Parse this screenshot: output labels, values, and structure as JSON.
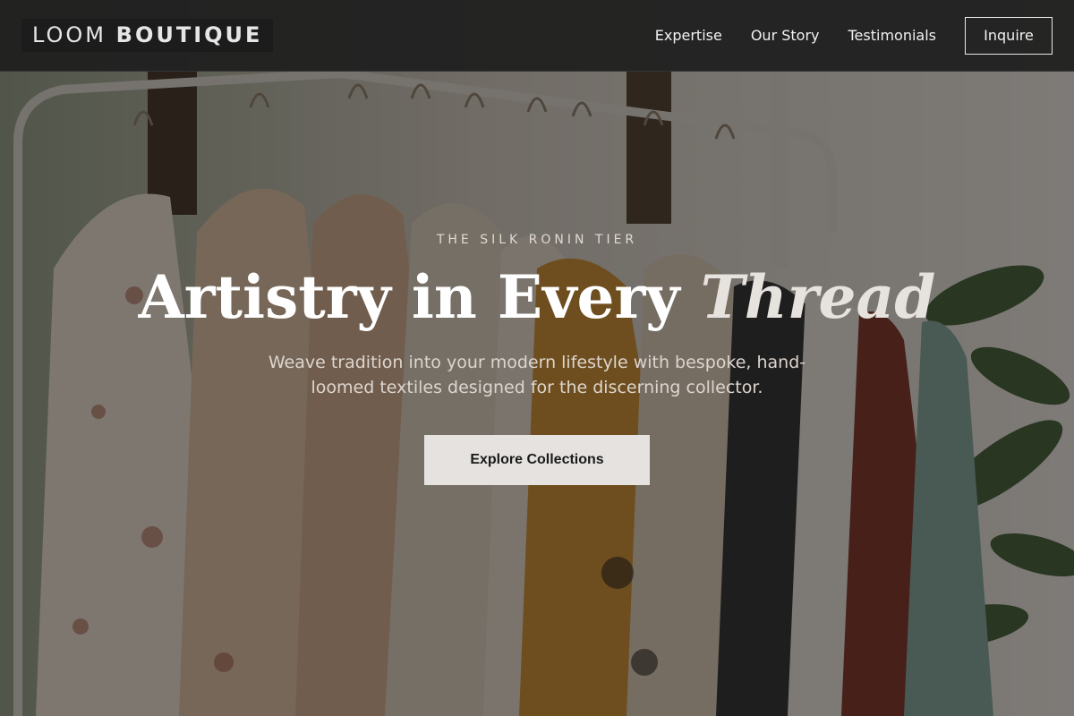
{
  "nav": {
    "logo_light": "LOOM",
    "logo_bold": "BOUTIQUE",
    "links": [
      "Expertise",
      "Our Story",
      "Testimonials"
    ],
    "cta_label": "Inquire"
  },
  "hero": {
    "eyebrow": "THE SILK RONIN TIER",
    "headline_main": "Artistry in Every",
    "headline_accent": "Thread",
    "subtitle": "Weave tradition into your modern lifestyle with bespoke, hand-loomed textiles designed for the discerning collector.",
    "cta_label": "Explore Collections",
    "background_image": "clothing-rack-with-hanging-garments"
  },
  "colors": {
    "nav_bg": "#1e1e1e",
    "button_bg": "#e5e2df",
    "accent_text": "#e6e2dd"
  }
}
